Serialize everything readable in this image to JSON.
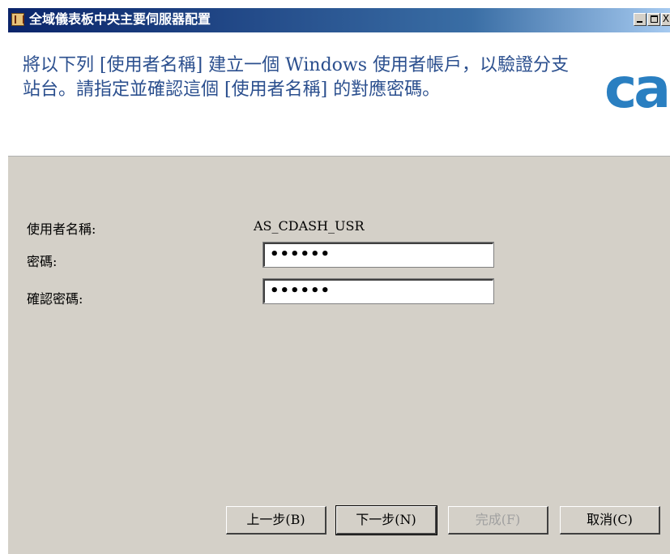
{
  "window": {
    "title": "全域儀表板中央主要伺服器配置",
    "close_glyph": "X"
  },
  "header": {
    "description_line1": "將以下列 [使用者名稱] 建立一個 Windows 使用者帳戶，以驗證分支",
    "description_line2": "站台。請指定並確認這個 [使用者名稱] 的對應密碼。",
    "logo_text": "ca",
    "logo_color": "#2a7fc1"
  },
  "form": {
    "username_label": "使用者名稱:",
    "username_value": "AS_CDASH_USR",
    "password_label": "密碼:",
    "password_value": "••••••",
    "confirm_label": "確認密碼:",
    "confirm_value": "••••••"
  },
  "buttons": {
    "back": "上一步(B)",
    "next": "下一步(N)",
    "finish": "完成(F)",
    "cancel": "取消(C)"
  },
  "colors": {
    "title_bar": "#0a246a",
    "panel": "#d4d0c8",
    "header_text": "#2b4f8e"
  }
}
